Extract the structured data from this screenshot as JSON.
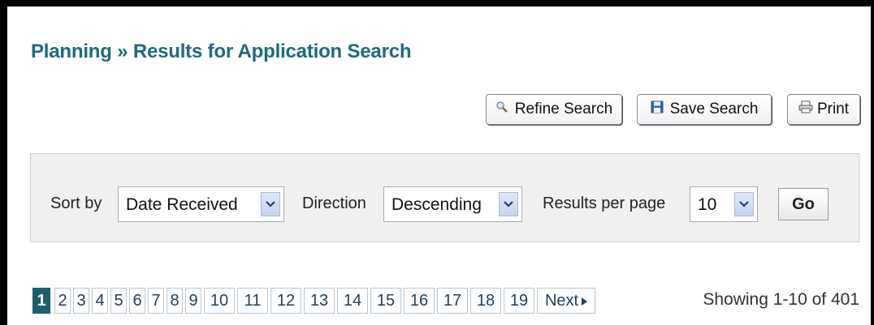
{
  "title": "Planning » Results for Application Search",
  "toolbar": {
    "refine_label": "Refine Search",
    "save_label": "Save Search",
    "print_label": "Print"
  },
  "sort": {
    "sort_by_label": "Sort by",
    "sort_by_value": "Date Received",
    "direction_label": "Direction",
    "direction_value": "Descending",
    "per_page_label": "Results per page",
    "per_page_value": "10",
    "go_label": "Go"
  },
  "pagination": {
    "pages": [
      "1",
      "2",
      "3",
      "4",
      "5",
      "6",
      "7",
      "8",
      "9",
      "10",
      "11",
      "12",
      "13",
      "14",
      "15",
      "16",
      "17",
      "18",
      "19"
    ],
    "current_page": "1",
    "next_label": "Next"
  },
  "results_summary": "Showing 1-10 of 401",
  "colors": {
    "title": "#1f6b78",
    "active_page": "#1b5f6f",
    "panel": "#f0f0f0"
  }
}
